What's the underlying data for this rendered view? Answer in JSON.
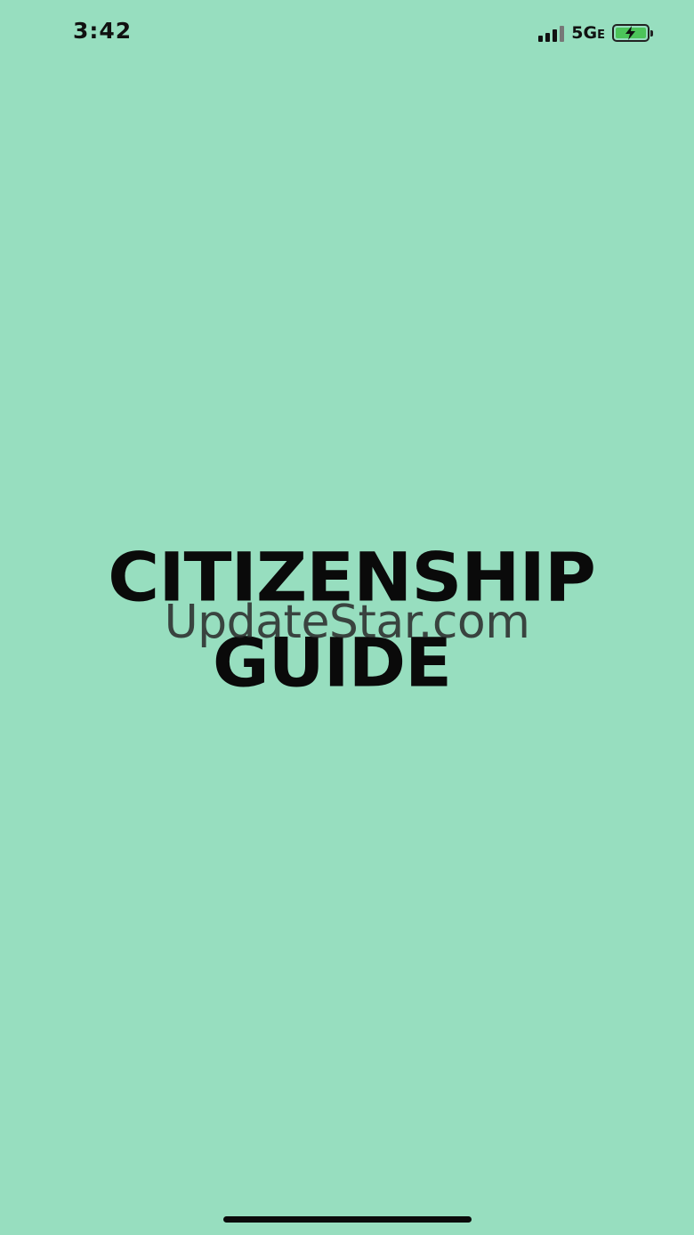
{
  "status_bar": {
    "time": "3:42",
    "network": "5G",
    "network_suffix": "E",
    "signal_icon": "cellular-signal-icon",
    "battery_icon": "battery-charging-icon"
  },
  "splash": {
    "title_line1": "CITIZENSHIP",
    "title_line2": "GUIDE",
    "watermark": "UpdateStar.com"
  },
  "colors": {
    "background": "#97DEBF",
    "logo_text": "#0A0A0A",
    "battery_fill": "#4CC45A"
  }
}
